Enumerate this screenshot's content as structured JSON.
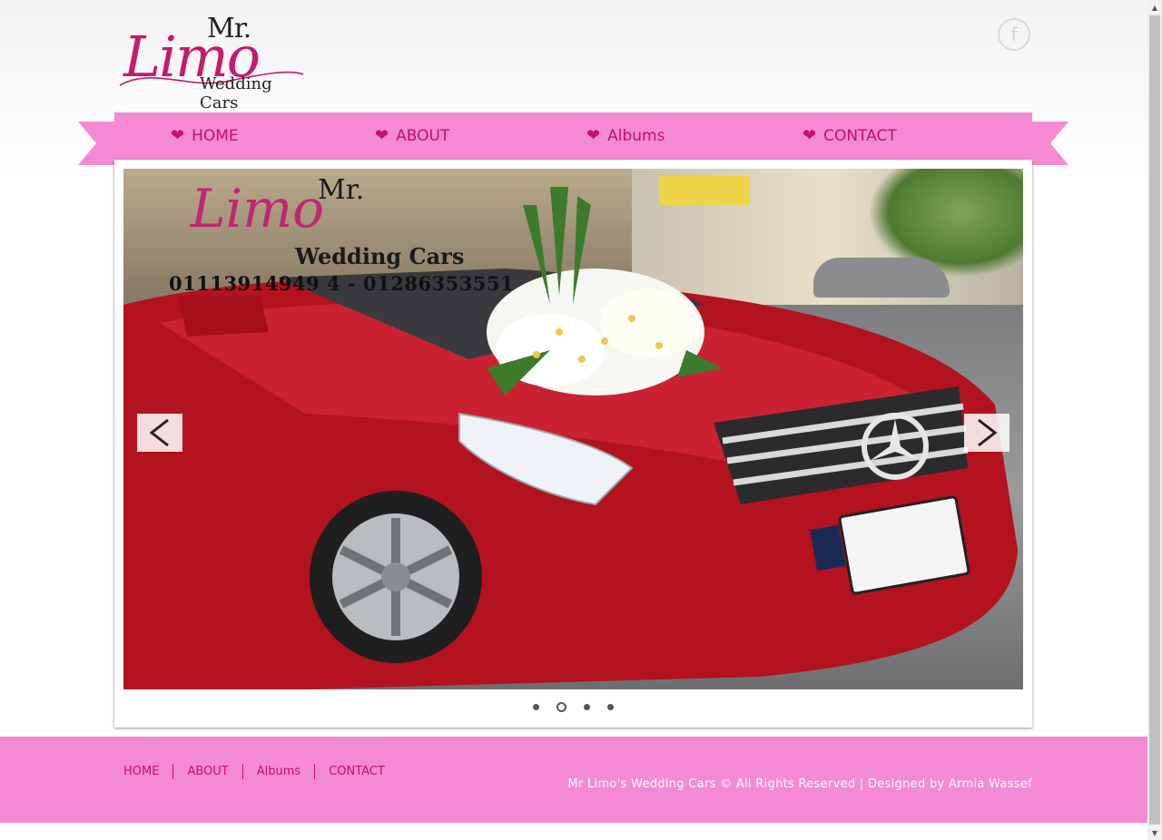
{
  "header": {
    "logo": {
      "mr": "Mr.",
      "limo": "Limo",
      "subtitle": "Wedding Cars"
    },
    "social": {
      "facebook_icon": "f"
    }
  },
  "nav": {
    "items": [
      {
        "label": "HOME",
        "icon": "heart-icon"
      },
      {
        "label": "ABOUT",
        "icon": "heart-icon"
      },
      {
        "label": "Albums",
        "icon": "heart-icon"
      },
      {
        "label": "CONTACT",
        "icon": "heart-icon"
      }
    ],
    "heart_glyph": "❤"
  },
  "slider": {
    "overlay": {
      "mr": "Mr.",
      "limo": "Limo",
      "subtitle": "Wedding Cars",
      "phones": "01113914949 4 - 01286353551"
    },
    "slide_count": 4,
    "active_slide": 2
  },
  "footer": {
    "links": [
      "HOME",
      "ABOUT",
      "Albums",
      "CONTACT"
    ],
    "copyright": "Mr Limo's Wedding Cars © All Rights Reserved | Designed by Armia Wassef"
  },
  "colors": {
    "accent_pink": "#f48ad3",
    "text_magenta": "#c4106a",
    "logo_pink": "#c51a6e"
  }
}
